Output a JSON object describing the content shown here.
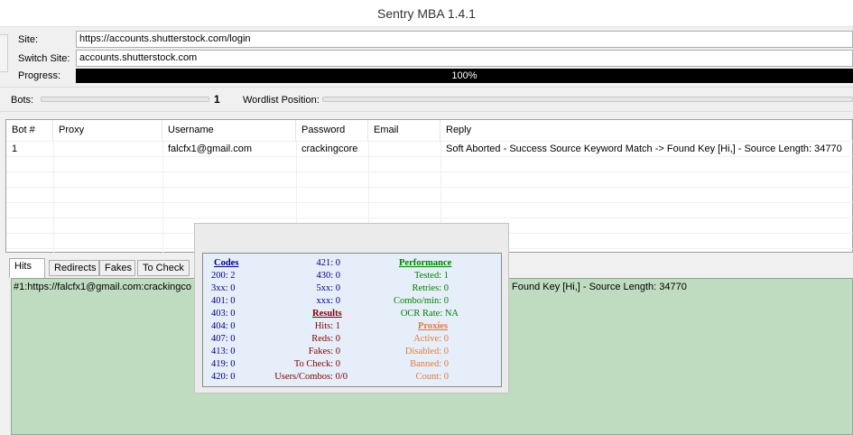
{
  "window": {
    "title": "Sentry MBA 1.4.1"
  },
  "site": {
    "label": "Site:",
    "value": "https://accounts.shutterstock.com/login"
  },
  "switch_site": {
    "label": "Switch Site:",
    "value": "accounts.shutterstock.com"
  },
  "progress": {
    "label": "Progress:",
    "value": 100,
    "text": "100%"
  },
  "bots": {
    "label": "Bots:",
    "value": "1"
  },
  "wordlist": {
    "label": "Wordlist Position:"
  },
  "table": {
    "columns": [
      "Bot #",
      "Proxy",
      "Username",
      "Password",
      "Email",
      "Reply"
    ],
    "rows": [
      {
        "bot": "1",
        "proxy": "",
        "username": "falcfx1@gmail.com",
        "password": "crackingcore",
        "email": "",
        "reply": "Soft Aborted - Success Source Keyword Match -> Found Key [Hi,] - Source Length: 34770"
      }
    ]
  },
  "tabs": [
    "Hits",
    "Redirects",
    "Fakes",
    "To Check"
  ],
  "hits": {
    "line_left": "#1:https://falcfx1@gmail.com:crackingco",
    "line_right": "Found Key [Hi,] - Source Length: 34770"
  },
  "stats": {
    "codes_header": "Codes",
    "codes_left": [
      "200: 2",
      "3xx: 0",
      "401: 0",
      "403: 0",
      "404: 0",
      "407: 0",
      "413: 0",
      "419: 0",
      "420: 0"
    ],
    "codes_mid": [
      "421: 0",
      "430: 0",
      "5xx: 0",
      "xxx: 0"
    ],
    "results_header": "Results",
    "results": [
      "Hits: 1",
      "Reds: 0",
      "Fakes: 0",
      "To Check: 0",
      "Users/Combos: 0/0"
    ],
    "performance_header": "Performance",
    "performance": [
      "Tested: 1",
      "Retries: 0",
      "Combo/min: 0",
      "OCR Rate: NA"
    ],
    "proxies_header": "Proxies",
    "proxies": [
      "Active: 0",
      "Disabled: 0",
      "Banned: 0",
      "Count: 0"
    ],
    "colors": {
      "codes": "#000080",
      "results": "#800000",
      "performance": "#007f00",
      "proxies": "#e07b3c"
    }
  }
}
